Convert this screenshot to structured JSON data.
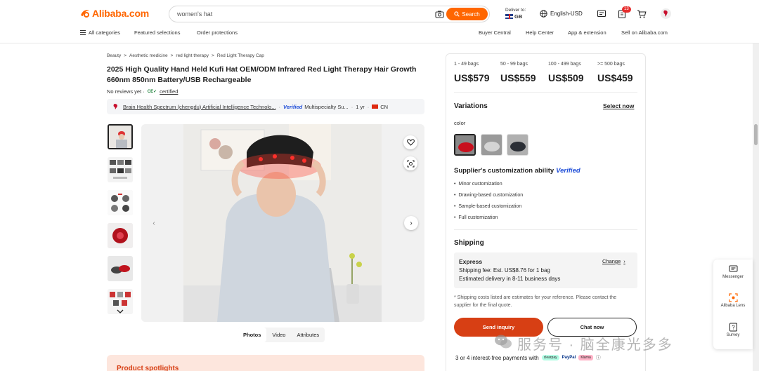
{
  "header": {
    "logo_text": "Alibaba.com",
    "search_placeholder": "women's hat",
    "search_button": "Search",
    "deliver_label": "Deliver to:",
    "deliver_country": "GB",
    "language": "English-USD",
    "cart_badge": "13",
    "brand_color": "#ff6600"
  },
  "nav": {
    "left": [
      "All categories",
      "Featured selections",
      "Order protections"
    ],
    "right": [
      "Buyer Central",
      "Help Center",
      "App & extension",
      "Sell on Alibaba.com"
    ]
  },
  "breadcrumb": [
    "Beauty",
    "Aesthetic medicine",
    "red light therapy",
    "Red Light Therapy Cap"
  ],
  "product": {
    "title": "2025 High Quality Hand Held Kufi Hat OEM/ODM Infrared Red Light Therapy Hair Growth 660nm 850nm Battery/USB Rechargeable",
    "reviews": "No reviews yet ·",
    "certified": "certified"
  },
  "supplier": {
    "name": "Brain Health Spectrum (chengdu) Artificial Intelligence Technolo...",
    "verified": "Verified",
    "type": "Multispecialty Su...",
    "years": "1 yr",
    "country": "CN"
  },
  "gallery_tabs": [
    "Photos",
    "Video",
    "Attributes"
  ],
  "spotlight": "Product spotlights",
  "pricing": [
    {
      "range": "1 - 49 bags",
      "price": "US$579"
    },
    {
      "range": "50 - 99 bags",
      "price": "US$559"
    },
    {
      "range": "100 - 499 bags",
      "price": "US$509"
    },
    {
      "range": ">= 500 bags",
      "price": "US$459"
    }
  ],
  "variations": {
    "title": "Variations",
    "select": "Select now",
    "color_label": "color"
  },
  "customization": {
    "title": "Supplier's customization ability",
    "verified": "Verified",
    "items": [
      "Minor customization",
      "Drawing-based customization",
      "Sample-based customization",
      "Full customization"
    ]
  },
  "shipping": {
    "title": "Shipping",
    "method": "Express",
    "change": "Change",
    "fee": "Shipping fee: Est. US$8.76 for 1 bag",
    "delivery": "Estimated delivery in 8-11 business days",
    "note": "* Shipping costs listed are estimates for your reference. Please contact the supplier for the final quote."
  },
  "actions": {
    "inquiry": "Send inquiry",
    "chat": "Chat now"
  },
  "payments": {
    "text": "3 or 4 interest-free payments with",
    "afterpay": "clearpay",
    "paypal": "PayPal",
    "klarna": "Klarna"
  },
  "side_widget": [
    "Messenger",
    "Alibaba Lens",
    "Survey"
  ],
  "watermark": "服务号 · 脑全康光多多"
}
